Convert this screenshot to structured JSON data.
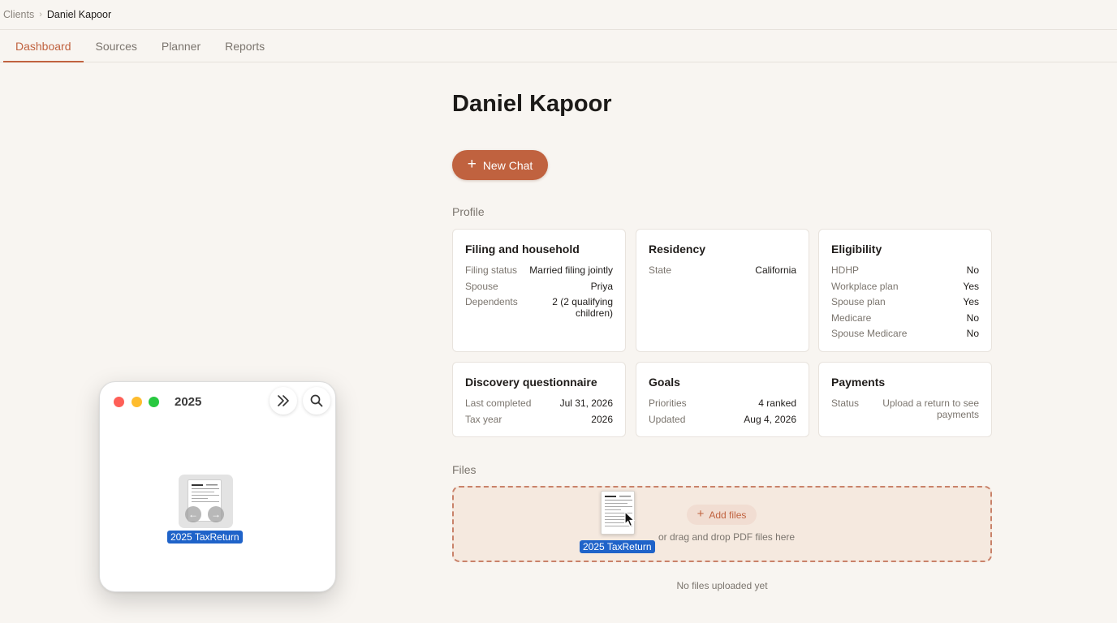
{
  "breadcrumb": {
    "root": "Clients",
    "separator": "›",
    "current": "Daniel Kapoor"
  },
  "tabs": [
    {
      "label": "Dashboard",
      "active": true
    },
    {
      "label": "Sources",
      "active": false
    },
    {
      "label": "Planner",
      "active": false
    },
    {
      "label": "Reports",
      "active": false
    }
  ],
  "client": {
    "name": "Daniel Kapoor"
  },
  "new_chat": {
    "label": "New Chat",
    "icon": "plus-icon"
  },
  "profile": {
    "label": "Profile",
    "cards": {
      "filing": {
        "title": "Filing and household",
        "rows": [
          {
            "k": "Filing status",
            "v": "Married filing jointly"
          },
          {
            "k": "Spouse",
            "v": "Priya"
          },
          {
            "k": "Dependents",
            "v": "2 (2 qualifying children)"
          }
        ]
      },
      "residency": {
        "title": "Residency",
        "rows": [
          {
            "k": "State",
            "v": "California"
          }
        ]
      },
      "eligibility": {
        "title": "Eligibility",
        "rows": [
          {
            "k": "HDHP",
            "v": "No"
          },
          {
            "k": "Workplace plan",
            "v": "Yes"
          },
          {
            "k": "Spouse plan",
            "v": "Yes"
          },
          {
            "k": "Medicare",
            "v": "No"
          },
          {
            "k": "Spouse Medicare",
            "v": "No"
          }
        ]
      },
      "discovery": {
        "title": "Discovery questionnaire",
        "rows": [
          {
            "k": "Last completed",
            "v": "Jul 31, 2026"
          },
          {
            "k": "Tax year",
            "v": "2026"
          }
        ]
      },
      "goals": {
        "title": "Goals",
        "rows": [
          {
            "k": "Priorities",
            "v": "4 ranked"
          },
          {
            "k": "Updated",
            "v": "Aug 4, 2026"
          }
        ]
      },
      "payments": {
        "title": "Payments",
        "rows": [
          {
            "k": "Status",
            "v": "Upload a return to see payments"
          }
        ]
      }
    }
  },
  "files": {
    "label": "Files",
    "add_label": "Add files",
    "hint": "or drag and drop PDF files here",
    "empty": "No files uploaded yet",
    "dragged_file": "2025 TaxReturn"
  },
  "finder": {
    "title": "2025",
    "file_name": "2025 TaxReturn",
    "buttons": [
      "chevron-double-right-icon",
      "search-icon"
    ]
  },
  "colors": {
    "accent": "#c0623f",
    "selection": "#1f63c9",
    "background": "#f8f5f1"
  }
}
